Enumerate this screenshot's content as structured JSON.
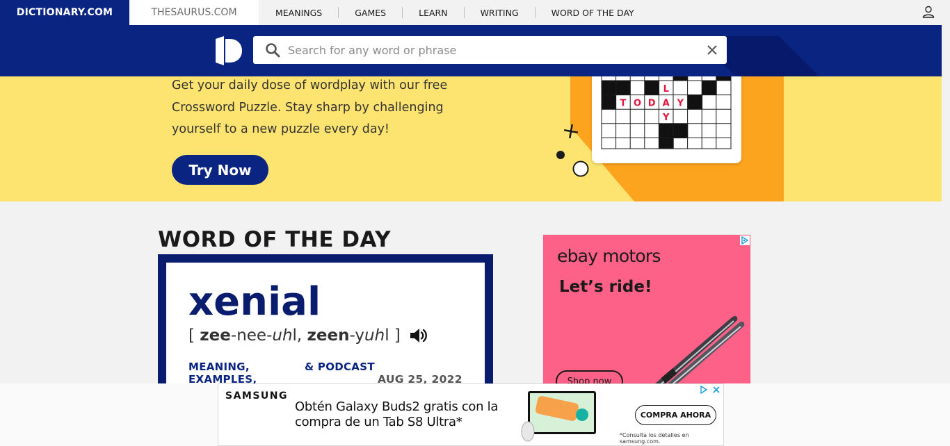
{
  "nav": {
    "dictionary_tab": "DICTIONARY.COM",
    "thesaurus_tab": "THESAURUS.COM",
    "links": [
      "MEANINGS",
      "GAMES",
      "LEARN",
      "WRITING",
      "WORD OF THE DAY"
    ]
  },
  "search": {
    "placeholder": "Search for any word or phrase"
  },
  "banner": {
    "text": "Get your daily dose of wordplay with our free Crossword Puzzle. Stay sharp by challenging yourself to a new puzzle every day!",
    "button_label": "Try Now",
    "crossword_letters": {
      "L": "L",
      "T": "T",
      "O": "O",
      "D": "D",
      "A": "A",
      "Y1": "Y",
      "Y2": "Y"
    }
  },
  "wotd": {
    "section_title": "WORD OF THE DAY",
    "word": "xenial",
    "pron_open": "[ ",
    "pron_p1_bold": "zee",
    "pron_p1_rest": "-nee-",
    "pron_p1_italic": "uh",
    "pron_p1_end": "l, ",
    "pron_p2_bold": "zeen",
    "pron_p2_rest": "-y",
    "pron_p2_italic": "uh",
    "pron_p2_end": "l",
    "pron_close": " ]",
    "link_meaning": "MEANING,",
    "link_examples": "EXAMPLES,",
    "link_podcast": "& PODCAST",
    "date": "AUG 25, 2022"
  },
  "ebay_ad": {
    "logo": "ebay motors",
    "tagline": "Let’s ride!",
    "button": "Shop now"
  },
  "samsung_ad": {
    "brand": "SAMSUNG",
    "text": "Obtén Galaxy Buds2 gratis con la compra de un Tab S8 Ultra*",
    "cta": "COMPRA AHORA",
    "note": "*Consulta los detalles en samsung.com."
  },
  "colors": {
    "brand_blue": "#0a2482",
    "banner_yellow": "#fde36f",
    "banner_orange": "#fca41e",
    "ebay_pink": "#fd6187"
  }
}
